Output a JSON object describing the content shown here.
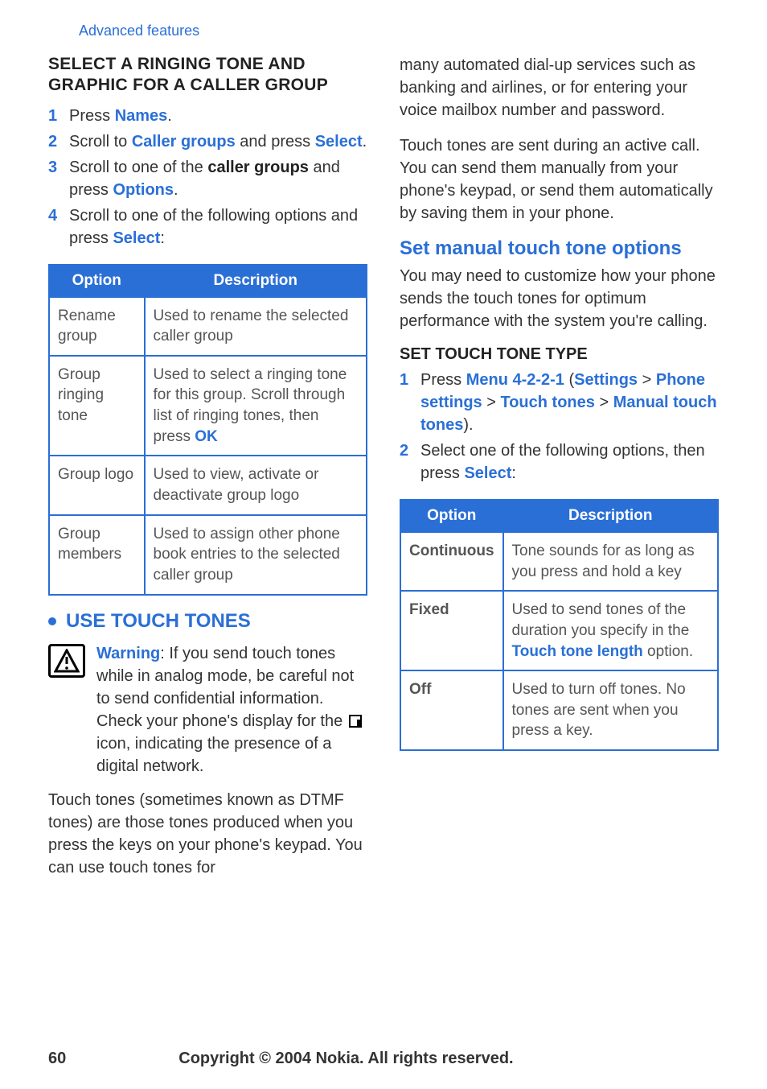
{
  "breadcrumb": "Advanced features",
  "left": {
    "heading": "SELECT A RINGING TONE AND GRAPHIC FOR A CALLER GROUP",
    "steps": [
      {
        "n": "1",
        "pre": "Press ",
        "hl": "Names",
        "post": "."
      },
      {
        "n": "2",
        "pre": "Scroll to ",
        "hl": "Caller groups",
        "mid": " and press ",
        "hl2": "Select",
        "post": "."
      },
      {
        "n": "3",
        "pre": "Scroll to one of the ",
        "bold": "caller groups",
        "mid": " and press ",
        "hl2": "Options",
        "post": "."
      },
      {
        "n": "4",
        "pre": "Scroll to one of the following options and press ",
        "hl": "Select",
        "post": ":"
      }
    ],
    "table": {
      "headers": [
        "Option",
        "Description"
      ],
      "rows": [
        {
          "opt": "Rename group",
          "desc": "Used to rename the selected caller group"
        },
        {
          "opt": "Group ringing tone",
          "desc_pre": "Used to select a ringing tone for this group. Scroll through list of ringing tones, then press ",
          "desc_hl": "OK"
        },
        {
          "opt": "Group logo",
          "desc": "Used to view, activate or deactivate group logo"
        },
        {
          "opt": "Group members",
          "desc": "Used to assign other phone book entries to the selected caller group"
        }
      ]
    },
    "touchHeading": "USE TOUCH TONES",
    "warning": {
      "label": "Warning",
      "text_pre": ": If you send touch tones while in analog mode, be careful not to send confidential information. Check your phone's display for the ",
      "text_post": " icon, indicating the presence of a digital network."
    },
    "paraBottom": "Touch tones (sometimes known as DTMF tones) are those tones produced when you press the keys on your phone's keypad. You can use touch tones for"
  },
  "right": {
    "paraTop": "many automated dial-up services such as banking and airlines, or for entering your voice mailbox number and password.",
    "para2": "Touch tones are sent during an active call. You can send them manually from your phone's keypad, or send them automatically by saving them in your phone.",
    "subhead": "Set manual touch tone options",
    "para3": "You may need to customize how your phone sends the touch tones for optimum performance with the system you're calling.",
    "sectionTitle": "SET TOUCH TONE TYPE",
    "steps": [
      {
        "n": "1",
        "pre": "Press ",
        "hl": "Menu 4-2-2-1",
        "open": " (",
        "b1": "Settings",
        "gt1": " > ",
        "b2": "Phone settings",
        "gt2": " > ",
        "b3": "Touch tones",
        "gt3": " > ",
        "b4": "Manual touch tones",
        "close": ")."
      },
      {
        "n": "2",
        "pre": "Select one of the following options, then press ",
        "hl": "Select",
        "post": ":"
      }
    ],
    "table": {
      "headers": [
        "Option",
        "Description"
      ],
      "rows": [
        {
          "opt": "Continuous",
          "desc": "Tone sounds for as long as you press and hold a key"
        },
        {
          "opt": "Fixed",
          "desc_pre": "Used to send tones of the duration you specify in the ",
          "desc_hl": "Touch tone length",
          "desc_post": " option."
        },
        {
          "opt": "Off",
          "desc": "Used to turn off tones. No tones are sent when you press a key."
        }
      ]
    }
  },
  "footer": {
    "page": "60",
    "copyright": "Copyright © 2004 Nokia. All rights reserved."
  }
}
